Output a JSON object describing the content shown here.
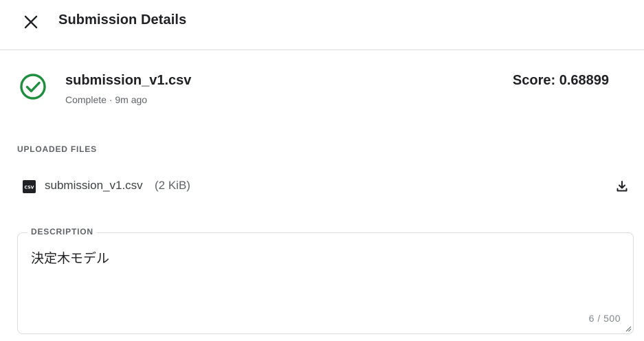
{
  "header": {
    "title": "Submission Details",
    "close_icon": "close-icon"
  },
  "submission": {
    "file_name": "submission_v1.csv",
    "status_text": "Complete · 9m ago",
    "status_icon": "check-circle-icon",
    "status_color": "#1e8e3e",
    "score_text": "Score: 0.68899"
  },
  "uploaded_files": {
    "label": "UPLOADED FILES",
    "files": [
      {
        "name": "submission_v1.csv",
        "size": "(2 KiB)",
        "icon": "csv-file-icon",
        "action_icon": "download-icon"
      }
    ]
  },
  "description": {
    "label": "DESCRIPTION",
    "value": "決定木モデル",
    "counter": "6 / 500"
  }
}
